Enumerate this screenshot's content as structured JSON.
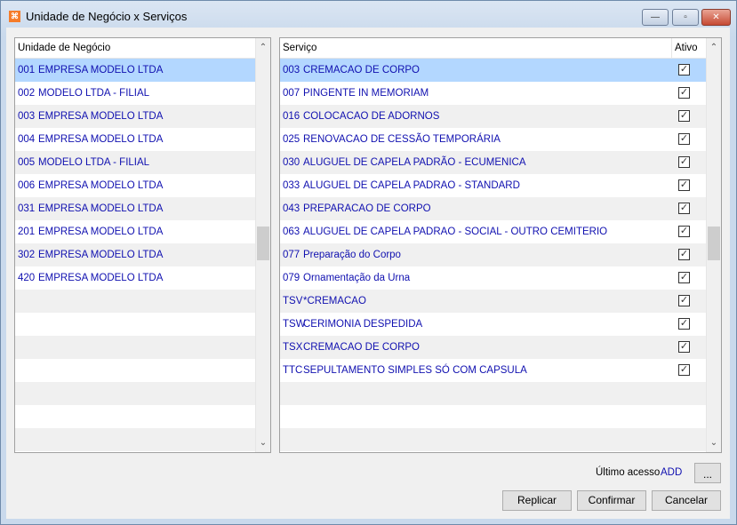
{
  "window": {
    "title": "Unidade de Negócio x Serviços",
    "icon": "app-logo-icon",
    "minimize": "—",
    "maximize": "▫",
    "close": "✕"
  },
  "left": {
    "header": "Unidade de Negócio",
    "rows": [
      {
        "code": "001",
        "name": "EMPRESA MODELO LTDA"
      },
      {
        "code": "002",
        "name": "MODELO LTDA - FILIAL"
      },
      {
        "code": "003",
        "name": "EMPRESA MODELO LTDA"
      },
      {
        "code": "004",
        "name": "EMPRESA MODELO LTDA"
      },
      {
        "code": "005",
        "name": "MODELO LTDA - FILIAL"
      },
      {
        "code": "006",
        "name": "EMPRESA MODELO LTDA"
      },
      {
        "code": "031",
        "name": "EMPRESA MODELO LTDA"
      },
      {
        "code": "201",
        "name": "EMPRESA MODELO LTDA"
      },
      {
        "code": "302",
        "name": "EMPRESA MODELO LTDA"
      },
      {
        "code": "420",
        "name": "EMPRESA MODELO LTDA"
      }
    ]
  },
  "right": {
    "header": "Serviço",
    "header_active": "Ativo",
    "rows": [
      {
        "code": "003",
        "name": "CREMACAO DE CORPO",
        "active": true
      },
      {
        "code": "007",
        "name": "PINGENTE IN MEMORIAM",
        "active": true
      },
      {
        "code": "016",
        "name": "COLOCACAO DE ADORNOS",
        "active": true
      },
      {
        "code": "025",
        "name": "RENOVACAO DE CESSÃO TEMPORÁRIA",
        "active": true
      },
      {
        "code": "030",
        "name": "ALUGUEL DE CAPELA PADRÃO - ECUMENICA",
        "active": true
      },
      {
        "code": "033",
        "name": "ALUGUEL DE CAPELA PADRAO - STANDARD",
        "active": true
      },
      {
        "code": "043",
        "name": "PREPARACAO DE CORPO",
        "active": true
      },
      {
        "code": "063",
        "name": "ALUGUEL DE CAPELA PADRAO - SOCIAL - OUTRO CEMITERIO",
        "active": true
      },
      {
        "code": "077",
        "name": "Preparação do Corpo",
        "active": true
      },
      {
        "code": "079",
        "name": "Ornamentação da Urna",
        "active": true
      },
      {
        "code": "TSV",
        "name": "*CREMACAO",
        "active": true
      },
      {
        "code": "TSW",
        "name": "CERIMONIA DESPEDIDA",
        "active": true
      },
      {
        "code": "TSX",
        "name": "CREMACAO DE CORPO",
        "active": true
      },
      {
        "code": "TTC",
        "name": "SEPULTAMENTO SIMPLES SÓ COM CAPSULA",
        "active": true
      }
    ]
  },
  "footer": {
    "last_access_label": "Último acesso",
    "last_access_value": "ADD",
    "ellipsis": "...",
    "replicar": "Replicar",
    "confirmar": "Confirmar",
    "cancelar": "Cancelar"
  }
}
